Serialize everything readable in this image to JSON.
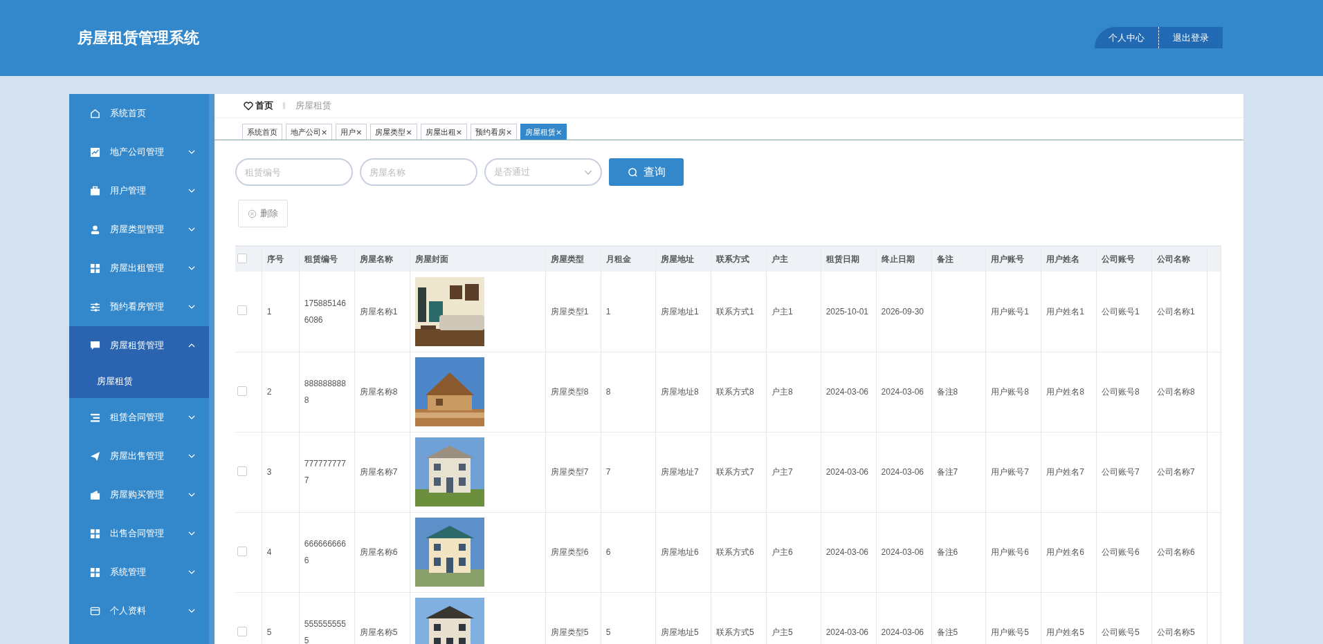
{
  "header": {
    "title": "房屋租赁管理系统",
    "links": [
      "个人中心",
      "退出登录"
    ]
  },
  "sidebar": {
    "items": [
      {
        "label": "系统首页",
        "selected": false
      },
      {
        "label": "地产公司管理",
        "expanded": false,
        "selected": false
      },
      {
        "label": "用户管理",
        "expanded": false,
        "selected": false
      },
      {
        "label": "房屋类型管理",
        "expanded": false,
        "selected": false
      },
      {
        "label": "房屋出租管理",
        "expanded": false,
        "selected": false
      },
      {
        "label": "预约看房管理",
        "expanded": false,
        "selected": false
      },
      {
        "label": "房屋租赁管理",
        "expanded": true,
        "selected": true,
        "children": [
          {
            "label": "房屋租赁"
          }
        ]
      },
      {
        "label": "租赁合同管理",
        "expanded": false,
        "selected": false
      },
      {
        "label": "房屋出售管理",
        "expanded": false,
        "selected": false
      },
      {
        "label": "房屋购买管理",
        "expanded": false,
        "selected": false
      },
      {
        "label": "出售合同管理",
        "expanded": false,
        "selected": false
      },
      {
        "label": "系统管理",
        "expanded": false,
        "selected": false
      },
      {
        "label": "个人资料",
        "expanded": false,
        "selected": false
      }
    ]
  },
  "breadcrumb": [
    "首页",
    "房屋租赁"
  ],
  "tabs": [
    {
      "label": "系统首页",
      "closable": false,
      "selected": false
    },
    {
      "label": "地产公司",
      "closable": true,
      "selected": false
    },
    {
      "label": "用户",
      "closable": true,
      "selected": false
    },
    {
      "label": "房屋类型",
      "closable": true,
      "selected": false
    },
    {
      "label": "房屋出租",
      "closable": true,
      "selected": false
    },
    {
      "label": "预约看房",
      "closable": true,
      "selected": false
    },
    {
      "label": "房屋租赁",
      "closable": true,
      "selected": true
    }
  ],
  "close_glyph": "×",
  "filters": [
    {
      "placeholder": "租赁编号",
      "kind": "text"
    },
    {
      "placeholder": "房屋名称",
      "kind": "text"
    },
    {
      "placeholder": "是否通过",
      "kind": "select"
    }
  ],
  "search_button": "查询",
  "delete_button": "删除",
  "table": {
    "all_checked": false,
    "columns": [
      "序号",
      "租赁编号",
      "房屋名称",
      "房屋封面",
      "房屋类型",
      "月租金",
      "房屋地址",
      "联系方式",
      "户主",
      "租赁日期",
      "终止日期",
      "备注",
      "用户账号",
      "用户姓名",
      "公司账号",
      "公司名称"
    ],
    "rows": [
      {
        "checked": false,
        "cells": [
          "1",
          "1758851466086",
          "房屋名称1",
          {
            "kind": "picture"
          },
          "房屋类型1",
          "1",
          "房屋地址1",
          "联系方式1",
          "户主1",
          "2025-10-01",
          "2026-09-30",
          "",
          "用户账号1",
          "用户姓名1",
          "公司账号1",
          "公司名称1"
        ]
      },
      {
        "checked": false,
        "cells": [
          "2",
          "8888888888",
          "房屋名称8",
          {
            "kind": "picture"
          },
          "房屋类型8",
          "8",
          "房屋地址8",
          "联系方式8",
          "户主8",
          "2024-03-06",
          "2024-03-06",
          "备注8",
          "用户账号8",
          "用户姓名8",
          "公司账号8",
          "公司名称8"
        ]
      },
      {
        "checked": false,
        "cells": [
          "3",
          "7777777777",
          "房屋名称7",
          {
            "kind": "picture"
          },
          "房屋类型7",
          "7",
          "房屋地址7",
          "联系方式7",
          "户主7",
          "2024-03-06",
          "2024-03-06",
          "备注7",
          "用户账号7",
          "用户姓名7",
          "公司账号7",
          "公司名称7"
        ]
      },
      {
        "checked": false,
        "cells": [
          "4",
          "6666666666",
          "房屋名称6",
          {
            "kind": "picture"
          },
          "房屋类型6",
          "6",
          "房屋地址6",
          "联系方式6",
          "户主6",
          "2024-03-06",
          "2024-03-06",
          "备注6",
          "用户账号6",
          "用户姓名6",
          "公司账号6",
          "公司名称6"
        ]
      },
      {
        "checked": false,
        "cells": [
          "5",
          "5555555555",
          "房屋名称5",
          {
            "kind": "picture"
          },
          "房屋类型5",
          "5",
          "房屋地址5",
          "联系方式5",
          "户主5",
          "2024-03-06",
          "2024-03-06",
          "备注5",
          "用户账号5",
          "用户姓名5",
          "公司账号5",
          "公司名称5"
        ]
      }
    ]
  }
}
